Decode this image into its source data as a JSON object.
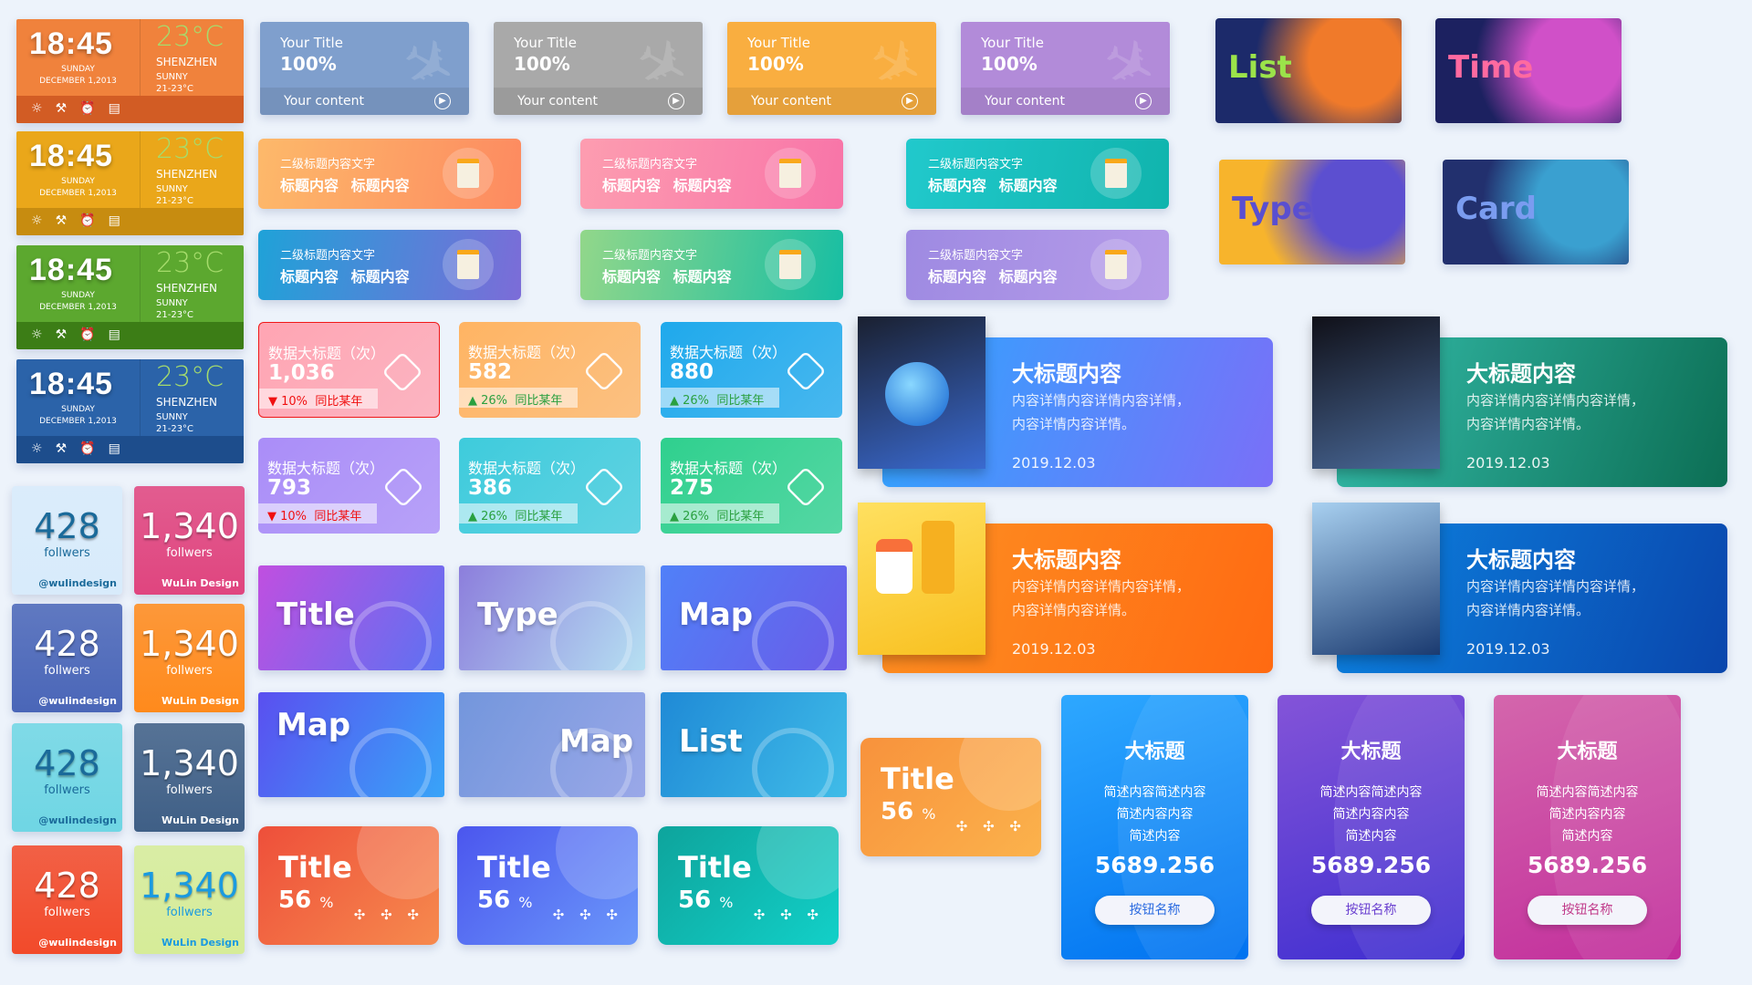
{
  "weather": [
    {
      "time": "18:45",
      "day": "SUNDAY",
      "date": "DECEMBER 1,2013",
      "temp": "23°C",
      "city": "SHENZHEN",
      "cond": "SUNNY",
      "range": "21-23°C",
      "color": "#f0823c",
      "bar": "#d25c24"
    },
    {
      "time": "18:45",
      "day": "SUNDAY",
      "date": "DECEMBER 1,2013",
      "temp": "23°C",
      "city": "SHENZHEN",
      "cond": "SUNNY",
      "range": "21-23°C",
      "color": "#eaa71a",
      "bar": "#c78c10"
    },
    {
      "time": "18:45",
      "day": "SUNDAY",
      "date": "DECEMBER 1,2013",
      "temp": "23°C",
      "city": "SHENZHEN",
      "cond": "SUNNY",
      "range": "21-23°C",
      "color": "#5ca82f",
      "bar": "#3c7d16"
    },
    {
      "time": "18:45",
      "day": "SUNDAY",
      "date": "DECEMBER 1,2013",
      "temp": "23°C",
      "city": "SHENZHEN",
      "cond": "SUNNY",
      "range": "21-23°C",
      "color": "#2b63a9",
      "bar": "#1d4d8c"
    }
  ],
  "weather_icons": [
    "bulb-icon",
    "wrench-icon",
    "alarm-icon",
    "contact-card-icon"
  ],
  "title_cards": [
    {
      "title": "Your Title",
      "value": "100%",
      "content": "Your content",
      "color": "#7f9fcd"
    },
    {
      "title": "Your Title",
      "value": "100%",
      "content": "Your content",
      "color": "#a9a9a9"
    },
    {
      "title": "Your Title",
      "value": "100%",
      "content": "Your content",
      "color": "#f9ae40"
    },
    {
      "title": "Your Title",
      "value": "100%",
      "content": "Your content",
      "color": "#b28bd9"
    }
  ],
  "image_cards": [
    {
      "label": "List",
      "colors": [
        "#1c2a6a",
        "#f07a2a"
      ]
    },
    {
      "label": "Time",
      "colors": [
        "#1c2160",
        "#d050c8"
      ]
    },
    {
      "label": "Type",
      "colors": [
        "#f7b42c",
        "#5c4fd0"
      ]
    },
    {
      "label": "Card",
      "colors": [
        "#22306e",
        "#3aa0d0"
      ]
    }
  ],
  "secondary_cards": [
    {
      "subtitle": "二级标题内容文字",
      "title": "标题内容 标题内容",
      "colors": [
        "#fdb96a",
        "#fd8a60"
      ]
    },
    {
      "subtitle": "二级标题内容文字",
      "title": "标题内容 标题内容",
      "colors": [
        "#fd9db0",
        "#f874a8"
      ]
    },
    {
      "subtitle": "二级标题内容文字",
      "title": "标题内容 标题内容",
      "colors": [
        "#21c9cc",
        "#10b4ad"
      ]
    },
    {
      "subtitle": "二级标题内容文字",
      "title": "标题内容 标题内容",
      "colors": [
        "#1fa2d8",
        "#7c6cd8"
      ]
    },
    {
      "subtitle": "二级标题内容文字",
      "title": "标题内容 标题内容",
      "colors": [
        "#92d78a",
        "#17bea3"
      ]
    },
    {
      "subtitle": "二级标题内容文字",
      "title": "标题内容 标题内容",
      "colors": [
        "#9e8ae2",
        "#b69ce9"
      ]
    }
  ],
  "data_cards": [
    {
      "title": "数据大标题（次）",
      "value": "1,036",
      "trend": "down",
      "pct": "10%",
      "note": "同比某年",
      "color": "#ffa5b3"
    },
    {
      "title": "数据大标题（次）",
      "value": "582",
      "trend": "up",
      "pct": "26%",
      "note": "同比某年",
      "color": "#ffb463"
    },
    {
      "title": "数据大标题（次）",
      "value": "880",
      "trend": "up",
      "pct": "26%",
      "note": "同比某年",
      "color": "#1fa9ec"
    },
    {
      "title": "数据大标题（次）",
      "value": "793",
      "trend": "down",
      "pct": "10%",
      "note": "同比某年",
      "color": "#aa8df8"
    },
    {
      "title": "数据大标题（次）",
      "value": "386",
      "trend": "up",
      "pct": "26%",
      "note": "同比某年",
      "color": "#3ecbdc"
    },
    {
      "title": "数据大标题（次）",
      "value": "275",
      "trend": "up",
      "pct": "26%",
      "note": "同比某年",
      "color": "#2fd08e"
    }
  ],
  "followers": [
    {
      "count": "428",
      "label": "follwers",
      "handle": "@wulindesign",
      "color": "#d8ebfb",
      "text": "#1a6a9a"
    },
    {
      "count": "1,340",
      "label": "follwers",
      "handle": "WuLin  Design",
      "color": "#e0457f",
      "text": "#ffffff"
    },
    {
      "count": "428",
      "label": "follwers",
      "handle": "@wulindesign",
      "color": "#4a66b8",
      "text": "#ffffff"
    },
    {
      "count": "1,340",
      "label": "follwers",
      "handle": "WuLin  Design",
      "color": "#ff8a1c",
      "text": "#ffffff"
    },
    {
      "count": "428",
      "label": "follwers",
      "handle": "@wulindesign",
      "color": "#6fd6e4",
      "text": "#1a6a9a"
    },
    {
      "count": "1,340",
      "label": "follwers",
      "handle": "WuLin  Design",
      "color": "#3f5f86",
      "text": "#ffffff"
    },
    {
      "count": "428",
      "label": "follwers",
      "handle": "@wulindesign",
      "color": "#f24a2a",
      "text": "#ffffff"
    },
    {
      "count": "1,340",
      "label": "follwers",
      "handle": "WuLin  Design",
      "color": "#d6ec98",
      "text": "#1a9ae0"
    }
  ],
  "tiles": [
    {
      "label": "Title",
      "colors": [
        "#c04fe0",
        "#5b72f2"
      ]
    },
    {
      "label": "Type",
      "colors": [
        "#8c7edc",
        "#b6e0f2"
      ]
    },
    {
      "label": "Map",
      "colors": [
        "#5080f8",
        "#6a5ce8"
      ]
    },
    {
      "label": "Map",
      "colors": [
        "#5a4ff0",
        "#38a4f8"
      ]
    },
    {
      "label": "Map",
      "colors": [
        "#7396dc",
        "#9aa8e8"
      ]
    },
    {
      "label": "List",
      "colors": [
        "#1f8ad6",
        "#40bce8"
      ]
    }
  ],
  "percent_cards": [
    {
      "title": "Title",
      "value": "56",
      "unit": "%",
      "dots": "✣ ✣ ✣",
      "colors": [
        "#f8923c",
        "#fbb24c"
      ]
    },
    {
      "title": "Title",
      "value": "56",
      "unit": "%",
      "dots": "✣ ✣ ✣",
      "colors": [
        "#ee4f3a",
        "#f68a4e"
      ]
    },
    {
      "title": "Title",
      "value": "56",
      "unit": "%",
      "dots": "✣ ✣ ✣",
      "colors": [
        "#4b56ee",
        "#6b98fa"
      ]
    },
    {
      "title": "Title",
      "value": "56",
      "unit": "%",
      "dots": "✣ ✣ ✣",
      "colors": [
        "#0ea49c",
        "#12d0c8"
      ]
    }
  ],
  "photo_cards": [
    {
      "title": "大标题内容",
      "line1": "内容详情内容详情内容详情，",
      "line2": "内容详情内容详情。",
      "date": "2019.12.03",
      "colors": [
        "#2ea6ff",
        "#7a6ff8"
      ],
      "photo": [
        "#1a2030",
        "#3a6ad0"
      ]
    },
    {
      "title": "大标题内容",
      "line1": "内容详情内容详情内容详情，",
      "line2": "内容详情内容详情。",
      "date": "2019.12.03",
      "colors": [
        "#34bcaa",
        "#0c6e54"
      ],
      "photo": [
        "#101018",
        "#4a6a9a"
      ]
    },
    {
      "title": "大标题内容",
      "line1": "内容详情内容详情内容详情，",
      "line2": "内容详情内容详情。",
      "date": "2019.12.03",
      "colors": [
        "#fe9022",
        "#ff6a12"
      ],
      "photo": [
        "#ffe060",
        "#f8c020"
      ]
    },
    {
      "title": "大标题内容",
      "line1": "内容详情内容详情内容详情，",
      "line2": "内容详情内容详情。",
      "date": "2019.12.03",
      "colors": [
        "#0c82e0",
        "#0a46ac"
      ],
      "photo": [
        "#a8d0f0",
        "#1a3a70"
      ]
    }
  ],
  "tall_cards": [
    {
      "title": "大标题",
      "line1": "简述内容简述内容",
      "line2": "简述内容内容",
      "line3": "简述内容",
      "value": "5689.256",
      "button": "按钮名称",
      "colors": [
        "#2ea8ff",
        "#0072f0"
      ],
      "btn_text": "#2a6ae0"
    },
    {
      "title": "大标题",
      "line1": "简述内容简述内容",
      "line2": "简述内容内容",
      "line3": "简述内容",
      "value": "5689.256",
      "button": "按钮名称",
      "colors": [
        "#8454d8",
        "#3e2ed0"
      ],
      "btn_text": "#6a40d0"
    },
    {
      "title": "大标题",
      "line1": "简述内容简述内容",
      "line2": "简述内容内容",
      "line3": "简述内容",
      "value": "5689.256",
      "button": "按钮名称",
      "colors": [
        "#d466ac",
        "#c22e9c"
      ],
      "btn_text": "#c03a8a"
    }
  ]
}
